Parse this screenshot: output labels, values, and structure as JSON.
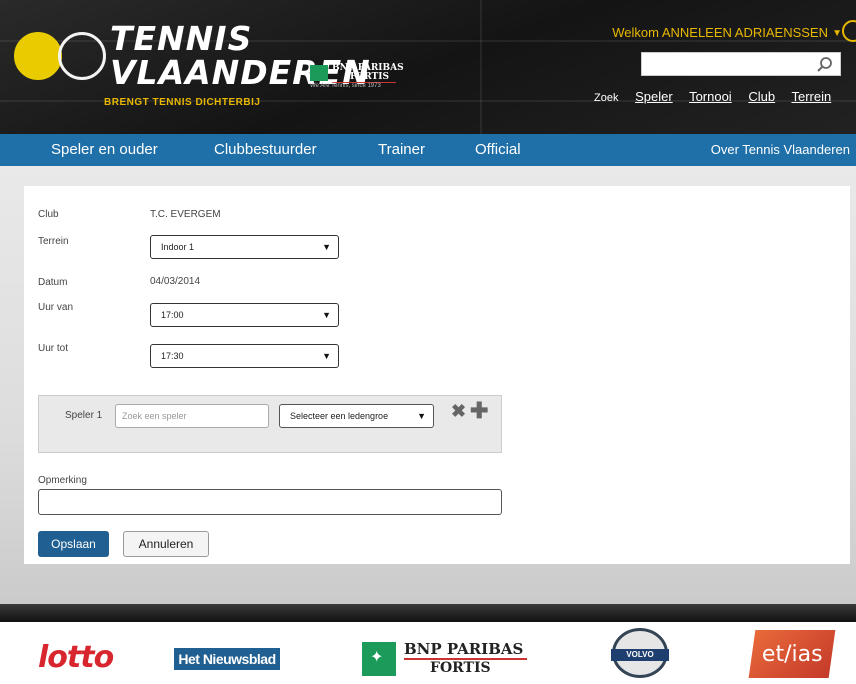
{
  "header": {
    "logo": {
      "title_line1": "TENNIS",
      "title_line2": "VLAANDEREN",
      "tagline": "BRENGT TENNIS DICHTERBIJ"
    },
    "sponsor_small": {
      "name_line1": "BNP PARIBAS",
      "name_line2": "FORTIS",
      "sub": "We Are Tennis, since 1973"
    },
    "welcome_text": "Welkom ANNELEEN ADRIAENSSEN",
    "search": {
      "placeholder": "",
      "icon": "search-icon"
    },
    "search_links": {
      "zoek_label": "Zoek",
      "items": [
        "Speler",
        "Tornooi",
        "Club",
        "Terrein"
      ]
    }
  },
  "nav": {
    "items": [
      "Speler en ouder",
      "Clubbestuurder",
      "Trainer",
      "Official"
    ],
    "right_item": "Over Tennis Vlaanderen"
  },
  "form": {
    "club_label": "Club",
    "club_value": "T.C. EVERGEM",
    "terrein_label": "Terrein",
    "terrein_value": "Indoor 1",
    "datum_label": "Datum",
    "datum_value": "04/03/2014",
    "uur_van_label": "Uur van",
    "uur_van_value": "17:00",
    "uur_tot_label": "Uur tot",
    "uur_tot_value": "17:30",
    "player": {
      "label": "Speler 1",
      "search_placeholder": "Zoek een speler",
      "group_select": "Selecteer een ledengroe"
    },
    "opmerking_label": "Opmerking",
    "opmerking_value": "",
    "save_label": "Opslaan",
    "cancel_label": "Annuleren"
  },
  "sponsors": {
    "lotto": "lotto",
    "nieuwsblad": "Het Nieuwsblad",
    "bnp_line1": "BNP PARIBAS",
    "bnp_line2": "FORTIS",
    "volvo": "VOLVO",
    "etihas": "et/ias"
  },
  "colors": {
    "accent_yellow": "#e8b800",
    "nav_blue": "#1f6fa8",
    "button_blue": "#1f5f91"
  }
}
